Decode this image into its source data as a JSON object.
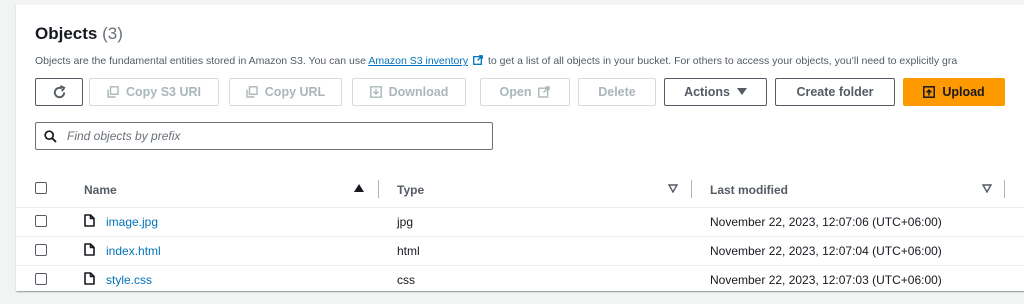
{
  "header": {
    "title": "Objects",
    "count": "(3)",
    "description_prefix": "Objects are the fundamental entities stored in Amazon S3. You can use ",
    "inventory_link": "Amazon S3 inventory",
    "description_suffix": " to get a list of all objects in your bucket. For others to access your objects, you’ll need to explicitly gra"
  },
  "toolbar": {
    "copy_s3_uri": "Copy S3 URI",
    "copy_url": "Copy URL",
    "download": "Download",
    "open": "Open",
    "delete": "Delete",
    "actions": "Actions",
    "create_folder": "Create folder",
    "upload": "Upload"
  },
  "search": {
    "placeholder": "Find objects by prefix"
  },
  "table": {
    "columns": {
      "name": "Name",
      "type": "Type",
      "last_modified": "Last modified"
    },
    "rows": [
      {
        "name": "image.jpg",
        "type": "jpg",
        "last_modified": "November 22, 2023, 12:07:06 (UTC+06:00)"
      },
      {
        "name": "index.html",
        "type": "html",
        "last_modified": "November 22, 2023, 12:07:04 (UTC+06:00)"
      },
      {
        "name": "style.css",
        "type": "css",
        "last_modified": "November 22, 2023, 12:07:03 (UTC+06:00)"
      }
    ]
  },
  "colors": {
    "accent": "#ff9900",
    "link": "#0073bb",
    "disabled": "#aab7b8"
  },
  "icons": {
    "refresh": "refresh-icon",
    "copy": "copy-icon",
    "download": "download-icon",
    "external": "external-link-icon",
    "dropdown": "caret-down-icon",
    "upload": "upload-icon",
    "search": "search-icon",
    "file": "file-icon",
    "sort": "sort-icon"
  }
}
